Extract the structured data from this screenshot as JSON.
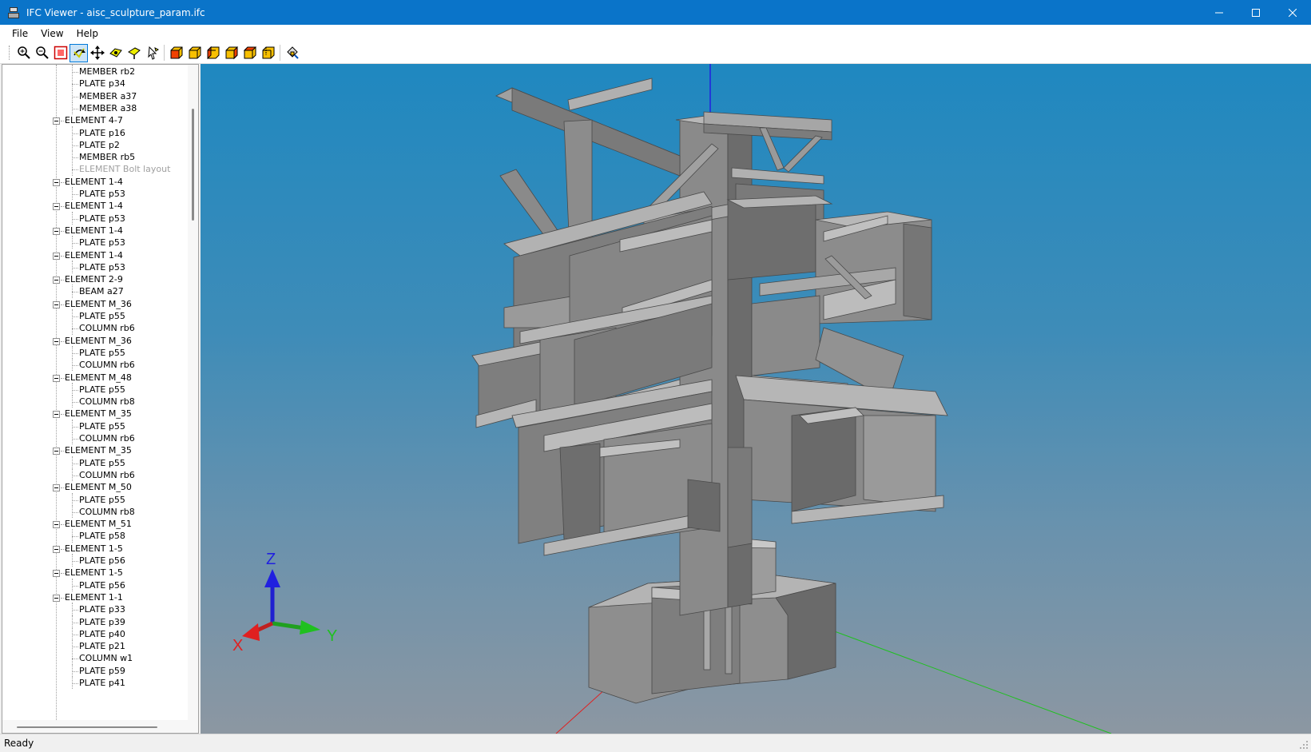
{
  "window": {
    "title": "IFC Viewer - aisc_sculpture_param.ifc"
  },
  "menu": {
    "items": [
      "File",
      "View",
      "Help"
    ]
  },
  "toolbar": {
    "buttons": [
      {
        "icon": "zoom-in-icon"
      },
      {
        "icon": "zoom-out-icon"
      },
      {
        "icon": "zoom-fit-icon"
      },
      {
        "icon": "rotate-icon",
        "active": true
      },
      {
        "icon": "pan-icon"
      },
      {
        "icon": "walk-icon"
      },
      {
        "icon": "fly-icon"
      },
      {
        "icon": "select-icon"
      },
      {
        "icon": "view-front-icon"
      },
      {
        "icon": "view-back-icon"
      },
      {
        "icon": "view-left-icon"
      },
      {
        "icon": "view-right-icon"
      },
      {
        "icon": "view-top-icon"
      },
      {
        "icon": "view-bottom-icon"
      },
      {
        "icon": "property-icon"
      }
    ]
  },
  "tree": {
    "rows": [
      {
        "level": 2,
        "label": "MEMBER rb2"
      },
      {
        "level": 2,
        "label": "PLATE p34"
      },
      {
        "level": 2,
        "label": "MEMBER a37"
      },
      {
        "level": 2,
        "label": "MEMBER a38"
      },
      {
        "level": 1,
        "label": "ELEMENT 4-7"
      },
      {
        "level": 2,
        "label": "PLATE p16"
      },
      {
        "level": 2,
        "label": "PLATE p2"
      },
      {
        "level": 2,
        "label": "MEMBER rb5"
      },
      {
        "level": 2,
        "label": "ELEMENT Bolt layout",
        "disabled": true
      },
      {
        "level": 1,
        "label": "ELEMENT 1-4"
      },
      {
        "level": 2,
        "label": "PLATE p53"
      },
      {
        "level": 1,
        "label": "ELEMENT 1-4"
      },
      {
        "level": 2,
        "label": "PLATE p53"
      },
      {
        "level": 1,
        "label": "ELEMENT 1-4"
      },
      {
        "level": 2,
        "label": "PLATE p53"
      },
      {
        "level": 1,
        "label": "ELEMENT 1-4"
      },
      {
        "level": 2,
        "label": "PLATE p53"
      },
      {
        "level": 1,
        "label": "ELEMENT 2-9"
      },
      {
        "level": 2,
        "label": "BEAM a27"
      },
      {
        "level": 1,
        "label": "ELEMENT M_36"
      },
      {
        "level": 2,
        "label": "PLATE p55"
      },
      {
        "level": 2,
        "label": "COLUMN rb6"
      },
      {
        "level": 1,
        "label": "ELEMENT M_36"
      },
      {
        "level": 2,
        "label": "PLATE p55"
      },
      {
        "level": 2,
        "label": "COLUMN rb6"
      },
      {
        "level": 1,
        "label": "ELEMENT M_48"
      },
      {
        "level": 2,
        "label": "PLATE p55"
      },
      {
        "level": 2,
        "label": "COLUMN rb8"
      },
      {
        "level": 1,
        "label": "ELEMENT M_35"
      },
      {
        "level": 2,
        "label": "PLATE p55"
      },
      {
        "level": 2,
        "label": "COLUMN rb6"
      },
      {
        "level": 1,
        "label": "ELEMENT M_35"
      },
      {
        "level": 2,
        "label": "PLATE p55"
      },
      {
        "level": 2,
        "label": "COLUMN rb6"
      },
      {
        "level": 1,
        "label": "ELEMENT M_50"
      },
      {
        "level": 2,
        "label": "PLATE p55"
      },
      {
        "level": 2,
        "label": "COLUMN rb8"
      },
      {
        "level": 1,
        "label": "ELEMENT M_51"
      },
      {
        "level": 2,
        "label": "PLATE p58"
      },
      {
        "level": 1,
        "label": "ELEMENT 1-5"
      },
      {
        "level": 2,
        "label": "PLATE p56"
      },
      {
        "level": 1,
        "label": "ELEMENT 1-5"
      },
      {
        "level": 2,
        "label": "PLATE p56"
      },
      {
        "level": 1,
        "label": "ELEMENT 1-1"
      },
      {
        "level": 2,
        "label": "PLATE p33"
      },
      {
        "level": 2,
        "label": "PLATE p39"
      },
      {
        "level": 2,
        "label": "PLATE p40"
      },
      {
        "level": 2,
        "label": "PLATE p21"
      },
      {
        "level": 2,
        "label": "COLUMN w1"
      },
      {
        "level": 2,
        "label": "PLATE p59"
      },
      {
        "level": 2,
        "label": "PLATE p41"
      }
    ]
  },
  "viewport": {
    "axes": {
      "x_label": "X",
      "y_label": "Y",
      "z_label": "Z"
    },
    "colors": {
      "x": "#e02020",
      "y": "#20c020",
      "z": "#2020e0",
      "steel": "#8c8c8c"
    }
  },
  "status": {
    "text": "Ready"
  }
}
